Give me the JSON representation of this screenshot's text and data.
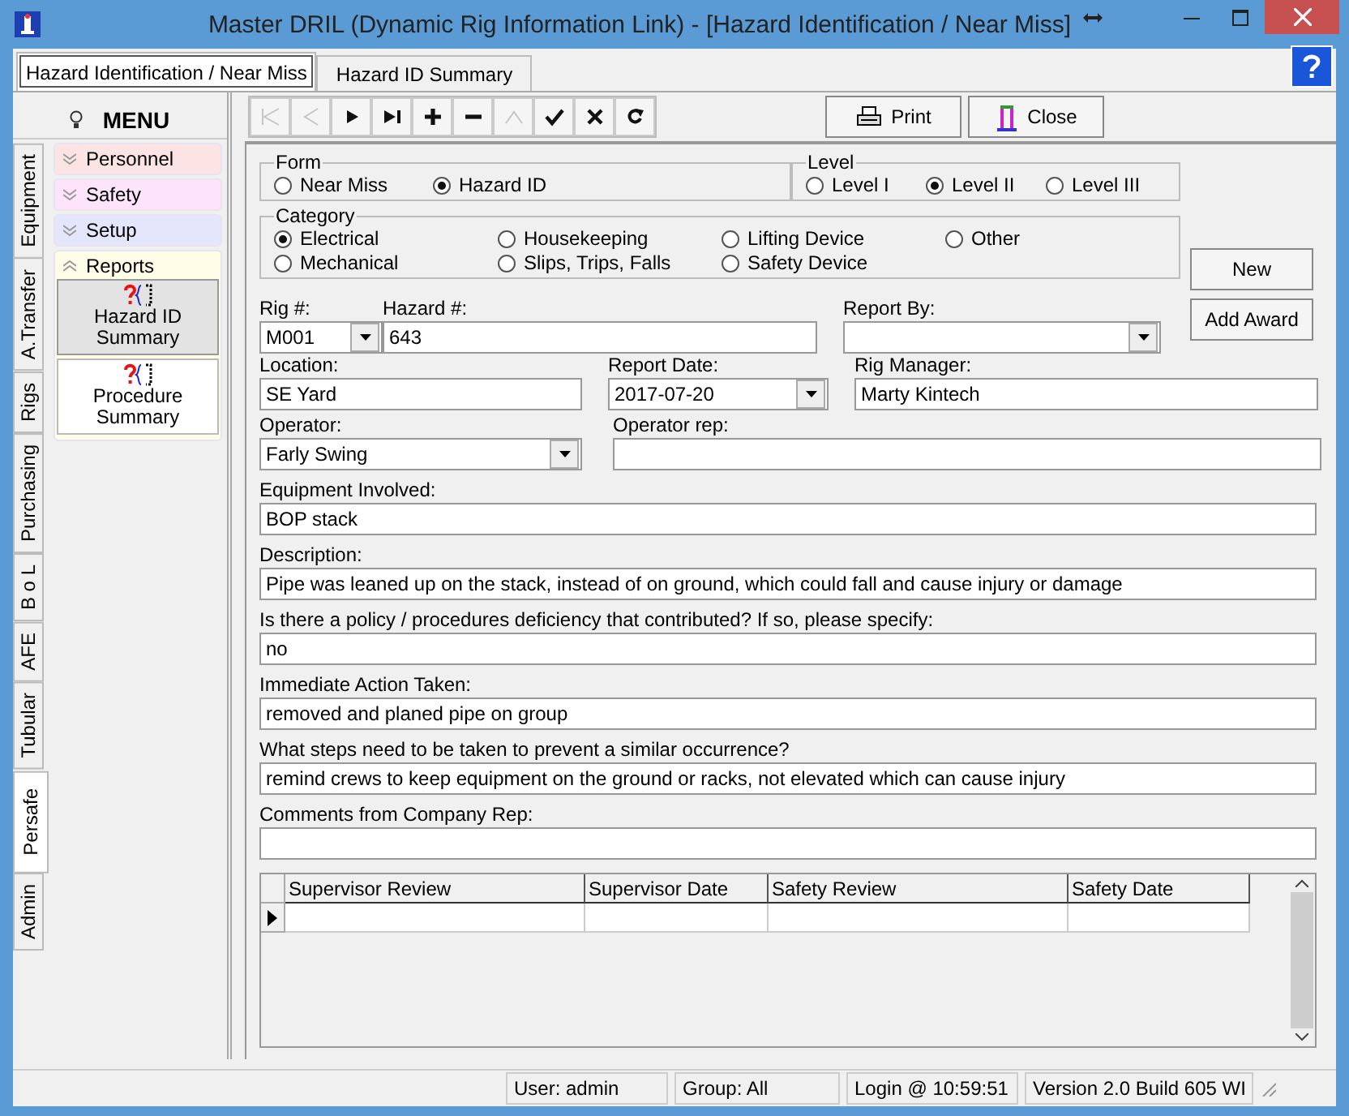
{
  "window": {
    "title": "Master DRIL (Dynamic Rig Information Link) - [Hazard Identification / Near Miss]"
  },
  "document_tabs": [
    {
      "label": "Hazard Identification / Near Miss",
      "selected": true
    },
    {
      "label": "Hazard ID Summary",
      "selected": false
    }
  ],
  "toolbar": {
    "buttons": [
      {
        "kind": "first",
        "disabled": true
      },
      {
        "kind": "prev",
        "disabled": true
      },
      {
        "kind": "next",
        "disabled": false
      },
      {
        "kind": "last",
        "disabled": false
      },
      {
        "kind": "add",
        "disabled": false
      },
      {
        "kind": "delete",
        "disabled": false
      },
      {
        "kind": "edit",
        "disabled": true
      },
      {
        "kind": "save",
        "disabled": false
      },
      {
        "kind": "cancel",
        "disabled": false
      },
      {
        "kind": "refresh",
        "disabled": false
      }
    ],
    "print": "Print",
    "close": "Close"
  },
  "menu": {
    "title": "MENU",
    "vertical_tabs": [
      {
        "label": "Equipment",
        "selected": false
      },
      {
        "label": "A.Transfer",
        "selected": false
      },
      {
        "label": "Rigs",
        "selected": false
      },
      {
        "label": "Purchasing",
        "selected": false
      },
      {
        "label": "B o L",
        "selected": false
      },
      {
        "label": "AFE",
        "selected": false
      },
      {
        "label": "Tubular",
        "selected": false
      },
      {
        "label": "Persafe",
        "selected": true
      },
      {
        "label": "Admin",
        "selected": false
      }
    ],
    "sections": [
      {
        "label": "Personnel",
        "expanded": false,
        "color": "#fde4e4"
      },
      {
        "label": "Safety",
        "expanded": false,
        "color": "#fde4fb"
      },
      {
        "label": "Setup",
        "expanded": false,
        "color": "#e4e6fb"
      },
      {
        "label": "Reports",
        "expanded": true,
        "color": "#fefde8",
        "items": [
          {
            "label": "Hazard ID Summary",
            "selected": true
          },
          {
            "label": "Procedure Summary",
            "selected": false
          }
        ]
      }
    ]
  },
  "form_type": {
    "label": "Form",
    "options": [
      {
        "label": "Near Miss",
        "selected": false
      },
      {
        "label": "Hazard ID",
        "selected": true
      }
    ]
  },
  "level": {
    "label": "Level",
    "options": [
      {
        "label": "Level I",
        "selected": false
      },
      {
        "label": "Level II",
        "selected": true
      },
      {
        "label": "Level III",
        "selected": false
      }
    ]
  },
  "category": {
    "label": "Category",
    "options": [
      {
        "label": "Electrical",
        "selected": true
      },
      {
        "label": "Housekeeping",
        "selected": false
      },
      {
        "label": "Lifting Device",
        "selected": false
      },
      {
        "label": "Other",
        "selected": false
      },
      {
        "label": "Mechanical",
        "selected": false
      },
      {
        "label": "Slips, Trips, Falls",
        "selected": false
      },
      {
        "label": "Safety Device",
        "selected": false
      }
    ]
  },
  "buttons": [
    "New",
    "Add Award"
  ],
  "fields": [
    {
      "label": "Rig #:",
      "value": "M001",
      "kind": "dropdown"
    },
    {
      "label": "Hazard #:",
      "value": "643",
      "kind": "text"
    },
    {
      "label": "Report By:",
      "kind": "dropdown"
    },
    {
      "label": "Location:",
      "value": "SE Yard",
      "kind": "text"
    },
    {
      "label": "Report Date:",
      "value": "2017-07-20",
      "kind": "dropdown"
    },
    {
      "label": "Rig Manager:",
      "value": "Marty Kintech",
      "kind": "text"
    },
    {
      "label": "Operator:",
      "value": "Farly Swing",
      "kind": "dropdown"
    },
    {
      "label": "Operator rep:",
      "kind": "text"
    }
  ],
  "questions": [
    {
      "label": "Equipment Involved:",
      "value": "BOP stack"
    },
    {
      "label": "Description:",
      "value": "Pipe was leaned up on the stack, instead of on ground, which could fall and cause injury or damage"
    },
    {
      "label": "Is there a  policy / procedures deficiency that contributed? If so, please specify:",
      "value": "no"
    },
    {
      "label": "Immediate Action Taken:",
      "value": "removed and planed pipe on group"
    },
    {
      "label": "What steps need to be taken to prevent a similar occurrence?",
      "value": "remind crews to keep equipment on the ground or racks, not elevated which can cause injury"
    },
    {
      "label": "Comments from Company Rep:"
    }
  ],
  "grid": {
    "columns": [
      "Supervisor Review",
      "Supervisor Date",
      "Safety Review",
      "Safety Date"
    ]
  },
  "status_bar": [
    "User: admin",
    "Group: All",
    "Login @ 10:59:51",
    "Version 2.0 Build 605 WI"
  ]
}
